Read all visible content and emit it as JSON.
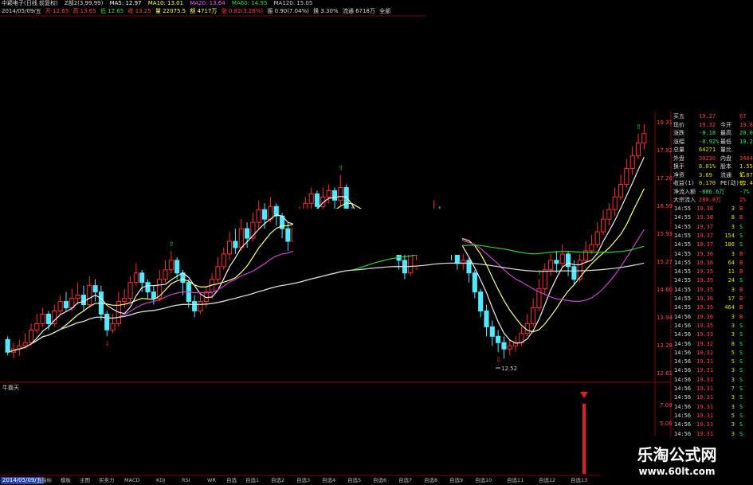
{
  "window": {
    "title": "中颖电子(日线 前复权)"
  },
  "indicator_row1": {
    "label": "Z部2(3,99,99)",
    "ma5": "MA5: 12.97",
    "ma10": "MA10: 13.01",
    "ma20": "MA20: 13.64",
    "ma60": "MA60: 14.95",
    "ma120": "MA120: 15.05"
  },
  "indicator_row2": {
    "date": "2014/05/09/五",
    "open": "开 12.65",
    "high": "高 13.65",
    "low": "低 12.65",
    "close": "收 13.25",
    "volume": "量 22075.5",
    "amount": "额 4717万",
    "change": "涨 0.82(3.28%)",
    "amplitude": "振 0.90(7.04%)",
    "turnover": "换 3.30%",
    "float": "流通 6718万",
    "extra": "全部"
  },
  "low_marker": "12.52",
  "sub_panel": {
    "title": "牛霸天"
  },
  "bottom_bar": {
    "date_box": "2014/05/09/五",
    "tabs": [
      "指标",
      "模板",
      "主图",
      "买卖力",
      "MACD",
      "KDJ",
      "RSI",
      "WR",
      "自选",
      "自选1",
      "自选2",
      "自选3",
      "自选4",
      "自选5",
      "自选6",
      "自选7",
      "自选8",
      "自选9",
      "自选10",
      "自选11",
      "自选12",
      "自选13"
    ]
  },
  "quote_panel": {
    "rows": [
      {
        "label": "买五",
        "value": "19.27",
        "label2": "",
        "value2": "67",
        "color": "#ff3b3b"
      },
      {
        "label": "现价",
        "value": "19.32",
        "label2": "今开",
        "value2": "19.88",
        "color": "#ff3b3b"
      },
      {
        "label": "涨跌",
        "value": "-0.18",
        "label2": "最高",
        "value2": "20.07",
        "color": "#2ee86a"
      },
      {
        "label": "涨幅",
        "value": "-0.92%",
        "label2": "最低",
        "value2": "19.28",
        "color": "#2ee86a"
      },
      {
        "label": "总量",
        "value": "64271",
        "label2": "量比",
        "value2": "",
        "color": "#e0e000"
      },
      {
        "label": "外盘",
        "value": "30230",
        "label2": "内盘",
        "value2": "34041",
        "color": "#ff3b3b"
      },
      {
        "label": "换手",
        "value": "6.01%",
        "label2": "股本",
        "value2": "1.55亿",
        "color": "#e0e000"
      },
      {
        "label": "净资",
        "value": "3.69",
        "label2": "流通",
        "value2": "1.07亿",
        "color": "#e0e000"
      },
      {
        "label": "收益(1)",
        "value": "0.170",
        "label2": "PE(动)",
        "value2": "92.4",
        "color": "#e0e000"
      },
      {
        "label": "净流入额",
        "value": "-886.6万",
        "label2": "",
        "value2": "-7%",
        "color": "#2ee86a"
      },
      {
        "label": "大宗流入",
        "value": "280.8万",
        "label2": "",
        "value2": "2%",
        "color": "#ff3b3b"
      }
    ],
    "price_axis": [
      "19.31",
      "17.92",
      "17.26",
      "16.59",
      "15.93",
      "15.27",
      "14.60",
      "13.94",
      "13.28",
      "12.61"
    ],
    "sub_axis": [
      "7.08",
      "5.06",
      "3.03",
      "1.01"
    ]
  },
  "trades": [
    {
      "time": "14:55",
      "price": "19.38",
      "vol": "3",
      "side": "B"
    },
    {
      "time": "14:55",
      "price": "19.38",
      "vol": "8",
      "side": "B"
    },
    {
      "time": "14:55",
      "price": "19.37",
      "vol": "3",
      "side": "S"
    },
    {
      "time": "14:55",
      "price": "19.37",
      "vol": "154",
      "side": "S"
    },
    {
      "time": "14:55",
      "price": "19.37",
      "vol": "186",
      "side": "S"
    },
    {
      "time": "14:55",
      "price": "19.36",
      "vol": "3",
      "side": "B"
    },
    {
      "time": "14:55",
      "price": "19.36",
      "vol": "64",
      "side": "B"
    },
    {
      "time": "14:55",
      "price": "19.35",
      "vol": "11",
      "side": "B"
    },
    {
      "time": "14:55",
      "price": "19.35",
      "vol": "24",
      "side": "S"
    },
    {
      "time": "14:55",
      "price": "19.35",
      "vol": "3",
      "side": "B"
    },
    {
      "time": "14:55",
      "price": "19.36",
      "vol": "17",
      "side": "B"
    },
    {
      "time": "14:55",
      "price": "19.35",
      "vol": "464",
      "side": "B"
    },
    {
      "time": "14:56",
      "price": "19.36",
      "vol": "3",
      "side": "B"
    },
    {
      "time": "14:56",
      "price": "19.35",
      "vol": "3",
      "side": "S"
    },
    {
      "time": "14:56",
      "price": "19.33",
      "vol": "3",
      "side": "S"
    },
    {
      "time": "14:56",
      "price": "19.32",
      "vol": "8",
      "side": "S"
    },
    {
      "time": "14:56",
      "price": "19.32",
      "vol": "5",
      "side": "S"
    },
    {
      "time": "14:56",
      "price": "19.31",
      "vol": "5",
      "side": "S"
    },
    {
      "time": "14:56",
      "price": "19.31",
      "vol": "3",
      "side": "S"
    },
    {
      "time": "14:56",
      "price": "19.31",
      "vol": "3",
      "side": "S"
    },
    {
      "time": "14:56",
      "price": "19.31",
      "vol": "7",
      "side": "S"
    },
    {
      "time": "14:56",
      "price": "19.31",
      "vol": "3",
      "side": "S"
    },
    {
      "time": "14:56",
      "price": "19.31",
      "vol": "3",
      "side": "S"
    },
    {
      "time": "14:56",
      "price": "19.31",
      "vol": "5",
      "side": "S"
    },
    {
      "time": "14:56",
      "price": "19.31",
      "vol": "3",
      "side": "S"
    },
    {
      "time": "14:56",
      "price": "19.31",
      "vol": "3",
      "side": "S"
    }
  ],
  "watermark": {
    "title": "乐淘公式网",
    "url": "www.60lt.com"
  },
  "chart_data": {
    "type": "candlestick",
    "ylim": [
      12.0,
      20.3
    ],
    "candles": [
      [
        13.1,
        12.7,
        13.2,
        12.6
      ],
      [
        12.7,
        12.8,
        13.0,
        12.5
      ],
      [
        12.8,
        12.9,
        13.1,
        12.6
      ],
      [
        12.9,
        13.0,
        13.3,
        12.8
      ],
      [
        13.0,
        13.4,
        13.6,
        12.9
      ],
      [
        13.4,
        13.6,
        13.9,
        13.3
      ],
      [
        13.6,
        13.9,
        14.1,
        13.5
      ],
      [
        13.9,
        13.6,
        14.0,
        13.4
      ],
      [
        13.6,
        14.0,
        14.2,
        13.5
      ],
      [
        14.0,
        14.3,
        14.5,
        13.9
      ],
      [
        14.3,
        14.1,
        14.6,
        14.0
      ],
      [
        14.1,
        14.4,
        14.7,
        14.0
      ],
      [
        14.4,
        14.5,
        14.9,
        14.2
      ],
      [
        14.5,
        14.2,
        14.8,
        14.0
      ],
      [
        14.2,
        14.8,
        15.1,
        14.1
      ],
      [
        14.8,
        14.6,
        15.0,
        14.3
      ],
      [
        14.6,
        13.9,
        14.8,
        13.7
      ],
      [
        13.9,
        13.4,
        14.0,
        13.2
      ],
      [
        13.4,
        13.6,
        13.9,
        13.3
      ],
      [
        13.6,
        14.3,
        14.6,
        13.5
      ],
      [
        14.3,
        14.4,
        14.7,
        14.1
      ],
      [
        14.4,
        14.9,
        15.1,
        14.3
      ],
      [
        14.9,
        15.2,
        15.5,
        14.8
      ],
      [
        15.2,
        14.9,
        15.3,
        14.6
      ],
      [
        14.9,
        14.6,
        15.0,
        14.4
      ],
      [
        14.6,
        14.4,
        14.8,
        14.2
      ],
      [
        14.4,
        15.0,
        15.3,
        14.3
      ],
      [
        15.0,
        15.3,
        15.6,
        14.9
      ],
      [
        15.3,
        15.6,
        15.9,
        15.2
      ],
      [
        15.6,
        15.2,
        15.7,
        15.0
      ],
      [
        15.2,
        14.9,
        15.3,
        14.5
      ],
      [
        14.9,
        14.3,
        15.0,
        14.1
      ],
      [
        14.3,
        14.0,
        14.5,
        13.8
      ],
      [
        14.0,
        14.3,
        14.5,
        13.9
      ],
      [
        14.3,
        14.6,
        14.8,
        14.1
      ],
      [
        14.6,
        15.0,
        15.2,
        14.4
      ],
      [
        15.0,
        15.4,
        15.7,
        14.9
      ],
      [
        15.4,
        15.8,
        16.0,
        15.3
      ],
      [
        15.8,
        16.2,
        16.5,
        15.6
      ],
      [
        16.2,
        16.0,
        16.6,
        15.8
      ],
      [
        16.0,
        16.6,
        16.9,
        15.9
      ],
      [
        16.6,
        16.3,
        16.8,
        16.0
      ],
      [
        16.3,
        16.8,
        17.1,
        16.2
      ],
      [
        16.8,
        17.2,
        17.5,
        16.6
      ],
      [
        17.2,
        16.9,
        17.4,
        16.6
      ],
      [
        16.9,
        17.3,
        17.6,
        16.8
      ],
      [
        17.3,
        17.0,
        17.4,
        16.7
      ],
      [
        17.0,
        16.6,
        17.1,
        16.3
      ],
      [
        16.6,
        16.2,
        16.8,
        15.9
      ],
      [
        16.2,
        16.6,
        16.9,
        16.0
      ],
      [
        16.6,
        17.1,
        17.3,
        16.5
      ],
      [
        17.1,
        17.4,
        17.6,
        16.9
      ],
      [
        17.4,
        17.7,
        17.9,
        17.2
      ],
      [
        17.7,
        17.3,
        17.8,
        17.0
      ],
      [
        17.3,
        17.6,
        17.9,
        17.1
      ],
      [
        17.6,
        17.8,
        18.0,
        17.4
      ],
      [
        17.8,
        17.5,
        17.9,
        17.1
      ],
      [
        17.5,
        17.9,
        18.3,
        17.3
      ],
      [
        17.9,
        17.2,
        18.0,
        16.9
      ],
      [
        17.2,
        16.4,
        17.3,
        16.1
      ],
      [
        16.4,
        16.0,
        16.6,
        15.8
      ],
      [
        16.0,
        16.4,
        16.7,
        15.9
      ],
      [
        16.4,
        16.8,
        17.0,
        16.2
      ],
      [
        16.8,
        16.5,
        17.0,
        16.3
      ],
      [
        16.5,
        16.2,
        16.7,
        16.0
      ],
      [
        16.2,
        16.5,
        16.8,
        16.1
      ],
      [
        16.5,
        16.1,
        16.6,
        15.9
      ],
      [
        16.1,
        15.6,
        16.2,
        15.3
      ],
      [
        15.6,
        15.2,
        15.8,
        15.0
      ],
      [
        15.2,
        15.8,
        16.1,
        15.1
      ],
      [
        15.8,
        16.2,
        16.4,
        15.6
      ],
      [
        16.2,
        16.6,
        16.9,
        16.1
      ],
      [
        16.6,
        16.9,
        17.1,
        16.4
      ],
      [
        16.9,
        17.2,
        17.5,
        16.7
      ],
      [
        17.2,
        16.8,
        17.3,
        16.5
      ],
      [
        16.8,
        16.3,
        16.9,
        16.0
      ],
      [
        16.3,
        15.9,
        16.4,
        15.6
      ],
      [
        15.9,
        15.5,
        16.0,
        15.3
      ],
      [
        15.5,
        15.6,
        15.8,
        15.3
      ],
      [
        15.6,
        15.2,
        15.7,
        14.9
      ],
      [
        15.2,
        14.6,
        15.3,
        14.4
      ],
      [
        14.6,
        14.0,
        14.7,
        13.8
      ],
      [
        14.0,
        13.5,
        14.2,
        13.2
      ],
      [
        13.5,
        13.2,
        13.7,
        12.9
      ],
      [
        13.2,
        13.0,
        13.4,
        12.7
      ],
      [
        13.0,
        12.8,
        13.2,
        12.5
      ],
      [
        12.8,
        12.9,
        13.1,
        12.6
      ],
      [
        12.9,
        13.0,
        13.2,
        12.7
      ],
      [
        13.0,
        13.3,
        13.5,
        12.9
      ],
      [
        13.3,
        13.6,
        13.9,
        13.2
      ],
      [
        13.6,
        14.1,
        14.4,
        13.5
      ],
      [
        14.1,
        14.7,
        15.0,
        14.0
      ],
      [
        14.7,
        15.3,
        15.5,
        14.5
      ],
      [
        15.3,
        15.6,
        15.8,
        15.1
      ],
      [
        15.6,
        15.5,
        15.9,
        15.2
      ],
      [
        15.5,
        15.8,
        16.1,
        15.4
      ],
      [
        15.8,
        15.4,
        15.9,
        15.1
      ],
      [
        15.4,
        15.0,
        15.6,
        14.8
      ],
      [
        15.0,
        15.6,
        15.8,
        14.9
      ],
      [
        15.6,
        15.9,
        16.2,
        15.5
      ],
      [
        15.9,
        16.1,
        16.4,
        15.8
      ],
      [
        16.1,
        16.5,
        16.8,
        16.0
      ],
      [
        16.5,
        16.9,
        17.2,
        16.4
      ],
      [
        16.9,
        17.2,
        17.4,
        16.7
      ],
      [
        17.2,
        17.6,
        17.9,
        17.0
      ],
      [
        17.6,
        18.0,
        18.3,
        17.5
      ],
      [
        18.0,
        18.5,
        18.8,
        17.9
      ],
      [
        18.5,
        18.9,
        19.2,
        18.3
      ],
      [
        18.9,
        19.3,
        19.6,
        18.8
      ],
      [
        19.3,
        19.6,
        19.9,
        19.1
      ]
    ],
    "x_axis_labels": []
  }
}
